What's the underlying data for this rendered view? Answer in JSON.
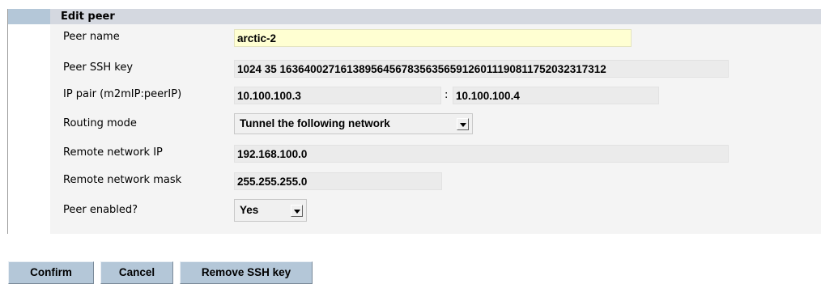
{
  "form": {
    "title": "Edit peer",
    "peer_name": {
      "label": "Peer name",
      "value": "arctic-2"
    },
    "ssh_key": {
      "label": "Peer SSH key",
      "value": "1024 35 163640027161389564567835635659126011190811752032317312"
    },
    "ip_pair": {
      "label": "IP pair (m2mIP:peerIP)",
      "m2m_ip": "10.100.100.3",
      "separator": ":",
      "peer_ip": "10.100.100.4"
    },
    "routing_mode": {
      "label": "Routing mode",
      "selected": "Tunnel the following network"
    },
    "remote_ip": {
      "label": "Remote network IP",
      "value": "192.168.100.0"
    },
    "remote_mask": {
      "label": "Remote network mask",
      "value": "255.255.255.0"
    },
    "enabled": {
      "label": "Peer enabled?",
      "selected": "Yes"
    }
  },
  "buttons": {
    "confirm": "Confirm",
    "cancel": "Cancel",
    "remove_key": "Remove SSH key"
  }
}
